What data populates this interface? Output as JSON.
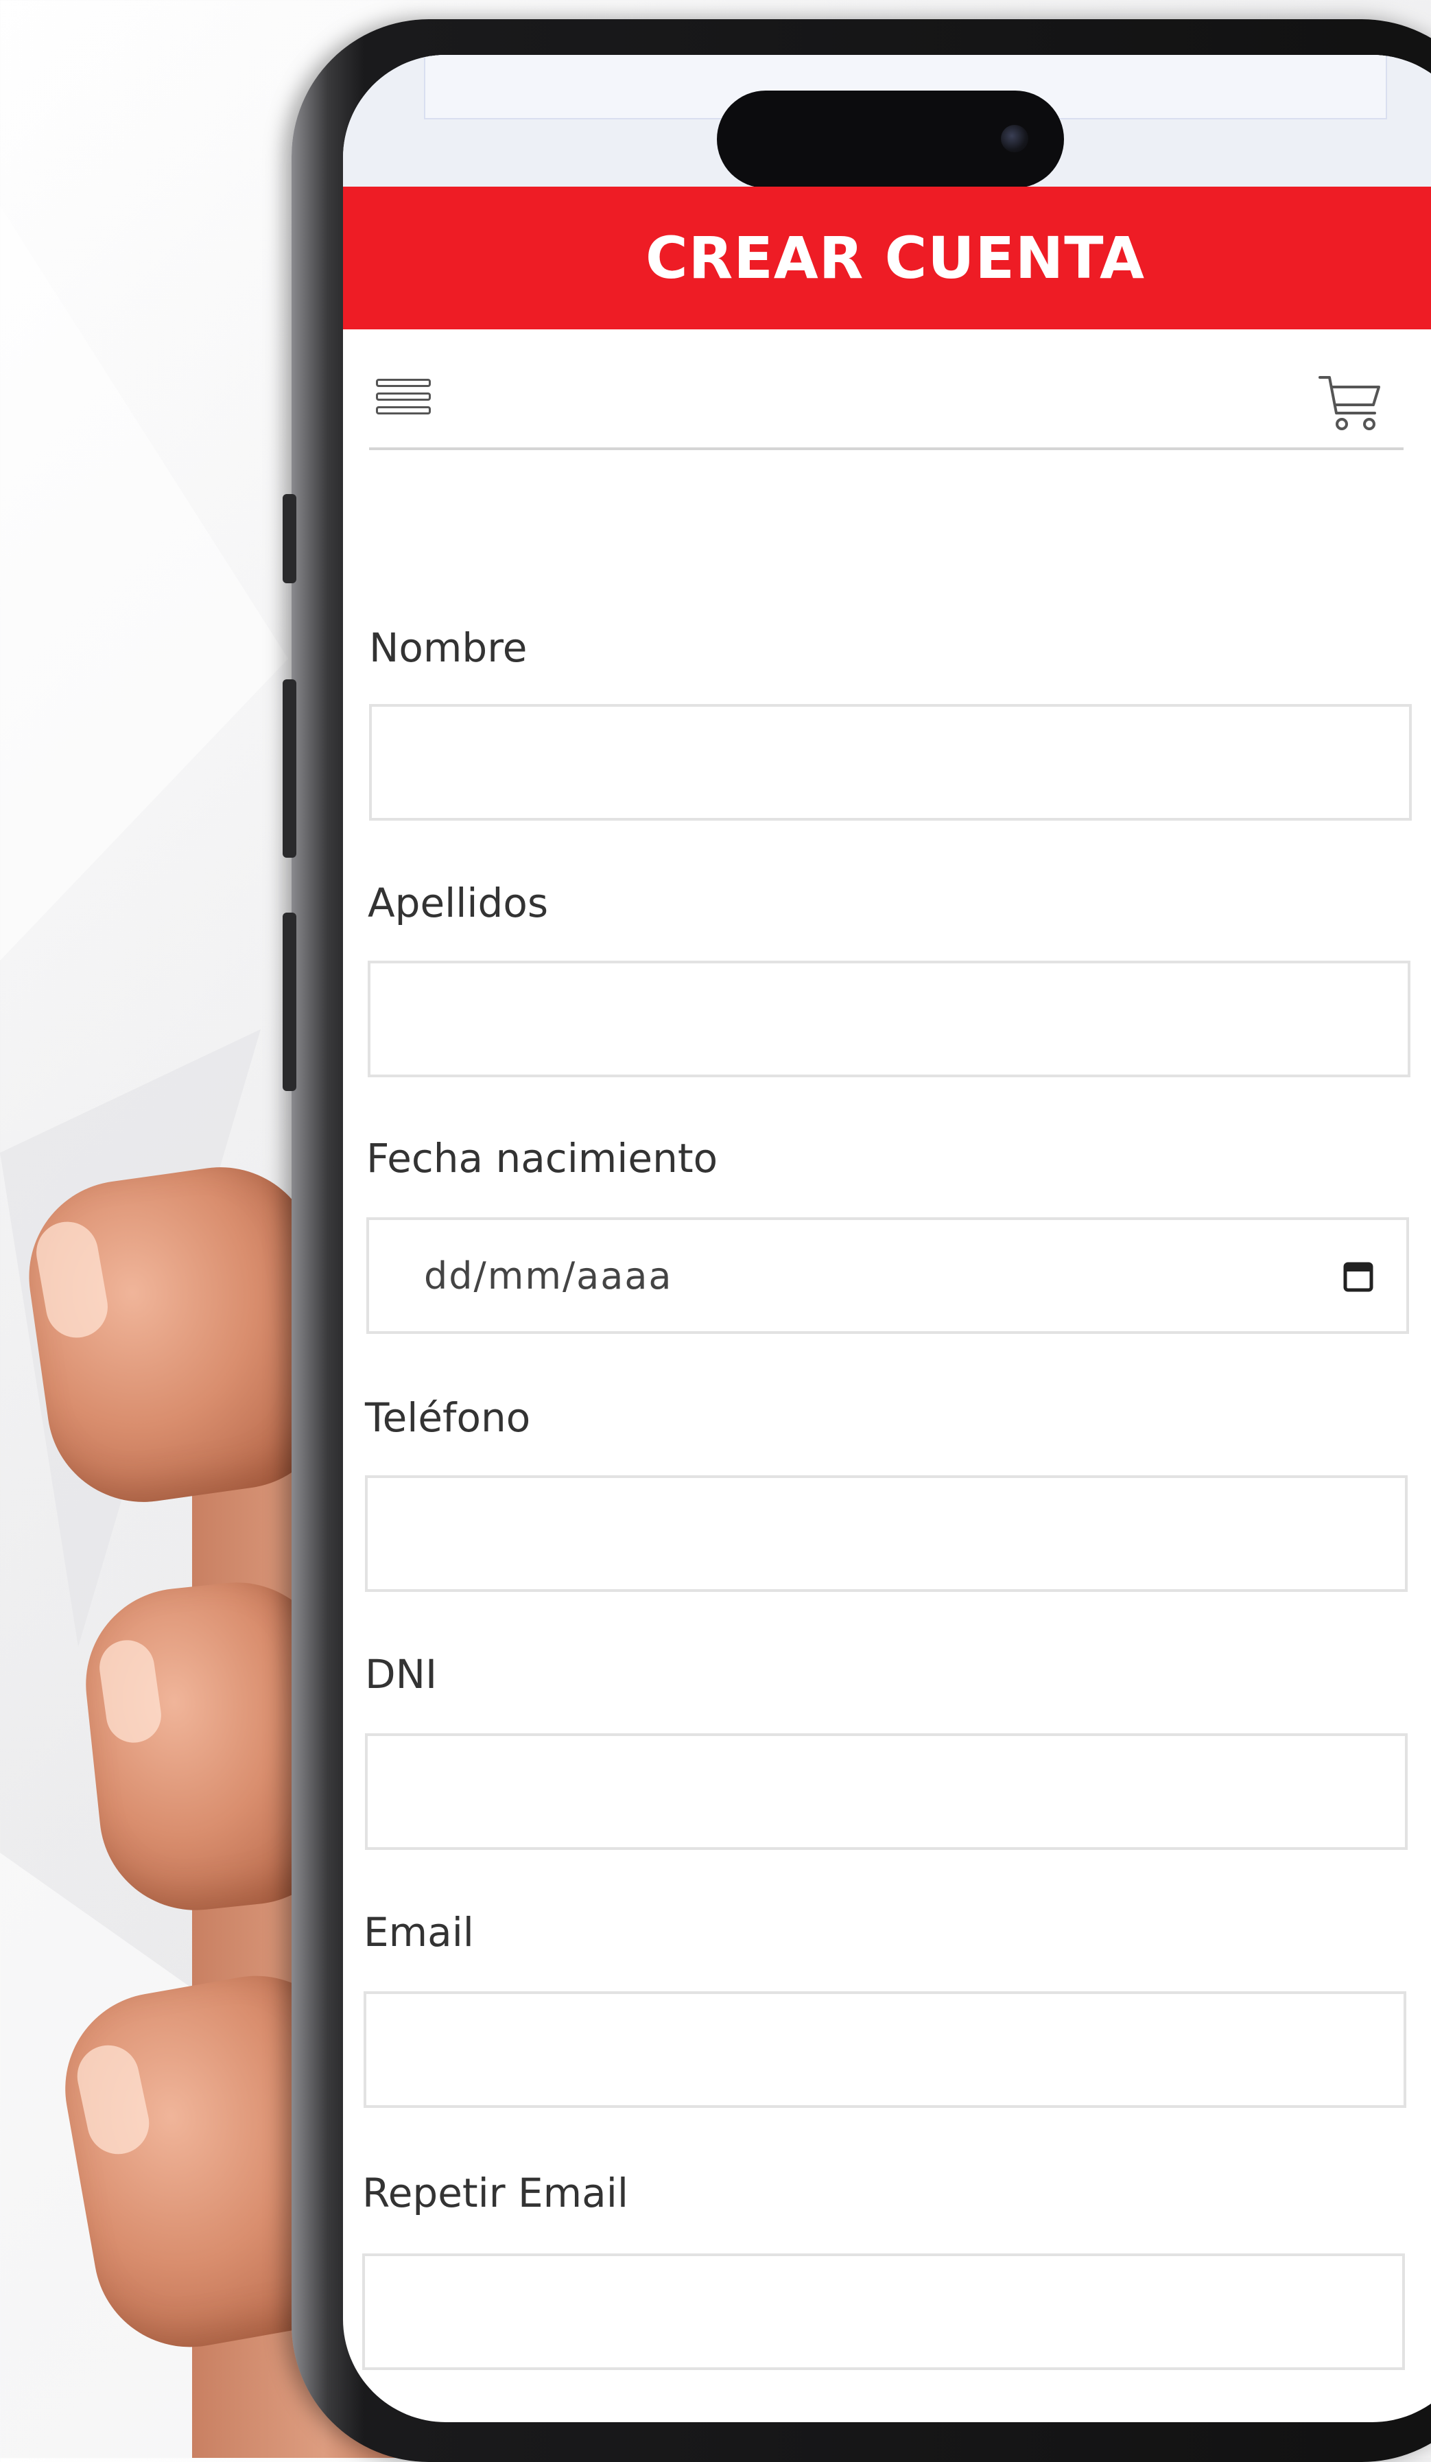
{
  "header": {
    "title": "CREAR CUENTA",
    "accent_color": "#ee1c25"
  },
  "nav": {
    "menu_icon": "hamburger-menu-icon",
    "cart_icon": "shopping-cart-icon"
  },
  "form": {
    "fields": [
      {
        "label": "Nombre",
        "value": ""
      },
      {
        "label": "Apellidos",
        "value": ""
      },
      {
        "label": "Fecha nacimiento",
        "placeholder": "dd/mm/aaaa",
        "icon": "calendar-icon"
      },
      {
        "label": "Teléfono",
        "value": ""
      },
      {
        "label": "DNI",
        "value": ""
      },
      {
        "label": "Email",
        "value": ""
      },
      {
        "label": "Repetir Email",
        "value": ""
      }
    ]
  }
}
